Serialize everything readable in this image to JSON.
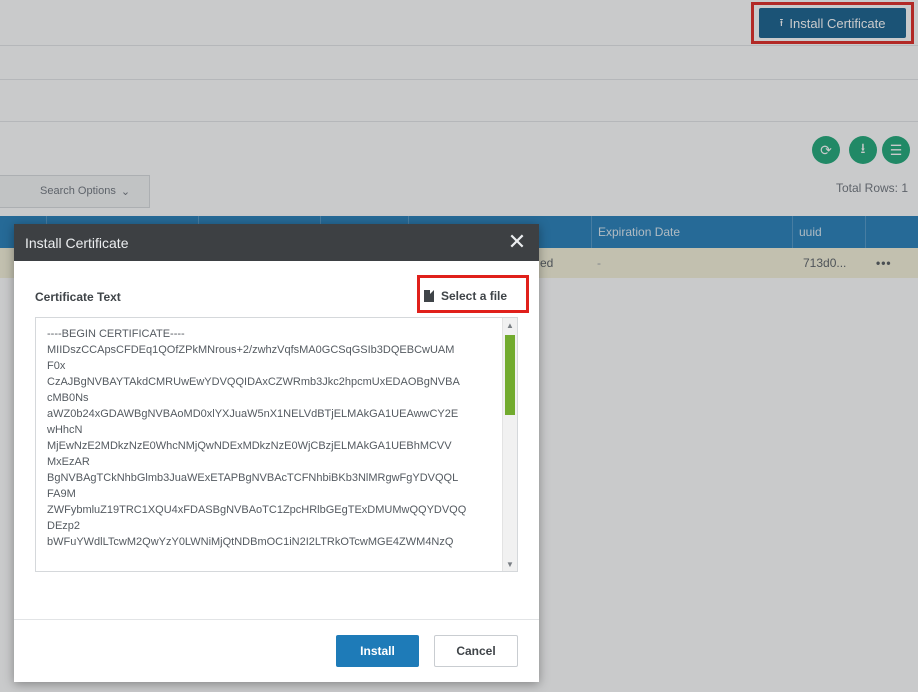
{
  "toolbar": {
    "install_certificate_label": "Install Certificate",
    "install_certificate_icon": "upload-icon",
    "action_icons": [
      "refresh-icon",
      "download-icon",
      "menu-icon"
    ]
  },
  "filters": {
    "search_options_label": "Search Options",
    "total_rows": "Total Rows: 1"
  },
  "table": {
    "columns": [
      "Expiration Date",
      "uuid"
    ],
    "rows": [
      {
        "status": "ed",
        "expiration_date": "-",
        "uuid": "713d0...",
        "more": "•••"
      }
    ]
  },
  "modal": {
    "title": "Install Certificate",
    "certificate_text_label": "Certificate Text",
    "select_file_label": "Select a file",
    "certificate_text": "----BEGIN CERTIFICATE----\nMIIDszCCApsCFDEq1QOfZPkMNrous+2/zwhzVqfsMA0GCSqGSIb3DQEBCwUAM\nF0x\nCzAJBgNVBAYTAkdCMRUwEwYDVQQIDAxCZWRmb3Jkc2hpcmUxEDAOBgNVBA\ncMB0Ns\naWZ0b24xGDAWBgNVBAoMD0xlYXJuaW5nX1NELVdBTjELMAkGA1UEAwwCY2E\nwHhcN\nMjEwNzE2MDkzNzE0WhcNMjQwNDExMDkzNzE0WjCBzjELMAkGA1UEBhMCVV\nMxEzAR\nBgNVBAgTCkNhbGlmb3JuaWExETAPBgNVBAcTCFNhbiBKb3NlMRgwFgYDVQQL\nFA9M\nZWFybmluZ19TRC1XQU4xFDASBgNVBAoTC1ZpcHRlbGEgTExDMUMwQQYDVQQ\nDEzp2\nbWFuYWdlLTcwM2QwYzY0LWNiMjQtNDBmOC1iN2I2LTRkOTcwMGE4ZWM4NzQ",
    "install_label": "Install",
    "cancel_label": "Cancel",
    "close_icon": "close-icon",
    "file_icon": "file-icon"
  },
  "colors": {
    "primary": "#1e7bb8",
    "dark_button": "#0f5a8a",
    "green": "#17a674",
    "highlight": "#e0201b"
  }
}
